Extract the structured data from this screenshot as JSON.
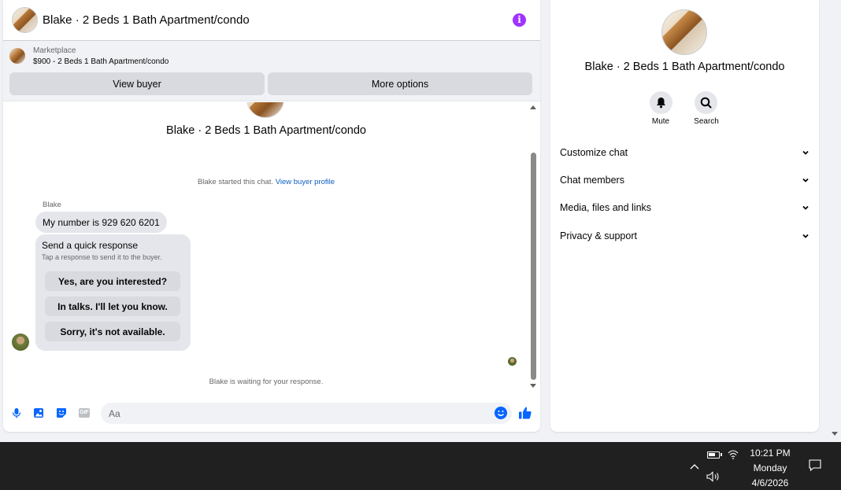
{
  "chat": {
    "title": "Blake · 2 Beds 1 Bath Apartment/condo",
    "info_icon": "info-icon",
    "marketplace": {
      "label": "Marketplace",
      "listing": "$900 - 2 Beds 1 Bath Apartment/condo"
    },
    "buttons": {
      "view_buyer": "View buyer",
      "more_options": "More options"
    },
    "conversation_title": "Blake · 2 Beds 1 Bath Apartment/condo",
    "started_text": "Blake started this chat.",
    "view_profile_link": "View buyer profile",
    "sender": "Blake",
    "message": "My number is 929 620 6201",
    "quick_response": {
      "title": "Send a quick response",
      "subtitle": "Tap a response to send it to the buyer.",
      "options": [
        "Yes, are you interested?",
        "In talks. I'll let you know.",
        "Sorry, it's not available."
      ]
    },
    "waiting_text": "Blake is waiting for your response.",
    "composer": {
      "placeholder": "Aa",
      "gif_label": "GIF"
    }
  },
  "info_panel": {
    "title": "Blake · 2 Beds 1 Bath Apartment/condo",
    "actions": [
      {
        "label": "Mute",
        "icon": "bell-icon"
      },
      {
        "label": "Search",
        "icon": "search-icon"
      }
    ],
    "menu": [
      "Customize chat",
      "Chat members",
      "Media, files and links",
      "Privacy & support"
    ]
  },
  "taskbar": {
    "time": "10:21 PM",
    "day": "Monday",
    "date": "4/6/2026"
  },
  "colors": {
    "accent": "#0866ff",
    "info_purple": "#a033ff",
    "link": "#0a5fbf"
  }
}
